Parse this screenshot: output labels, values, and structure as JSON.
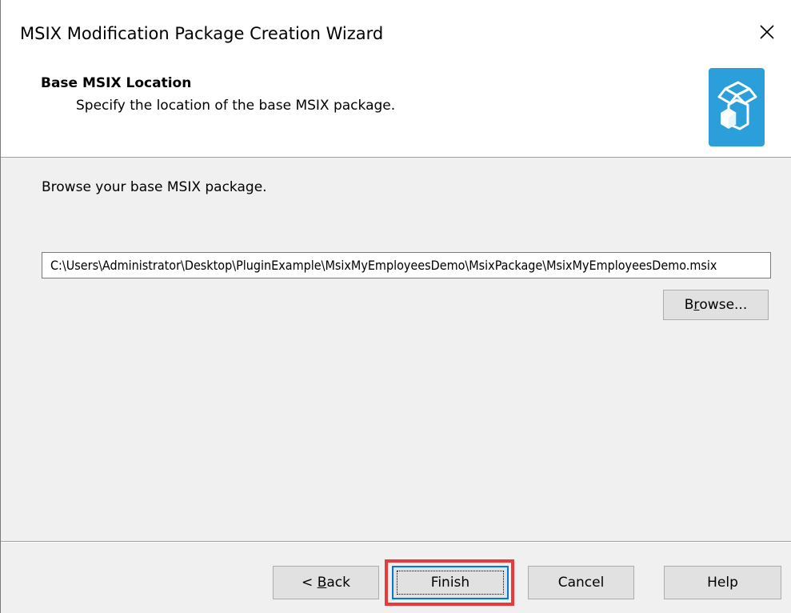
{
  "window": {
    "title": "MSIX Modification Package Creation Wizard",
    "close_icon": "close-icon"
  },
  "header": {
    "title": "Base MSIX Location",
    "subtitle": "Specify the location of the base MSIX package.",
    "icon": "package-box-icon",
    "icon_color": "#2b9fd9"
  },
  "content": {
    "instruction": "Browse your base MSIX package.",
    "path_value": "C:\\Users\\Administrator\\Desktop\\PluginExample\\MsixMyEmployeesDemo\\MsixPackage\\MsixMyEmployeesDemo.msix",
    "browse_prefix": "B",
    "browse_underlined": "r",
    "browse_suffix": "owse..."
  },
  "footer": {
    "back_prefix": "< ",
    "back_underlined": "B",
    "back_suffix": "ack",
    "finish_label": "Finish",
    "cancel_label": "Cancel",
    "help_label": "Help",
    "highlight_color": "#e83a3a"
  }
}
